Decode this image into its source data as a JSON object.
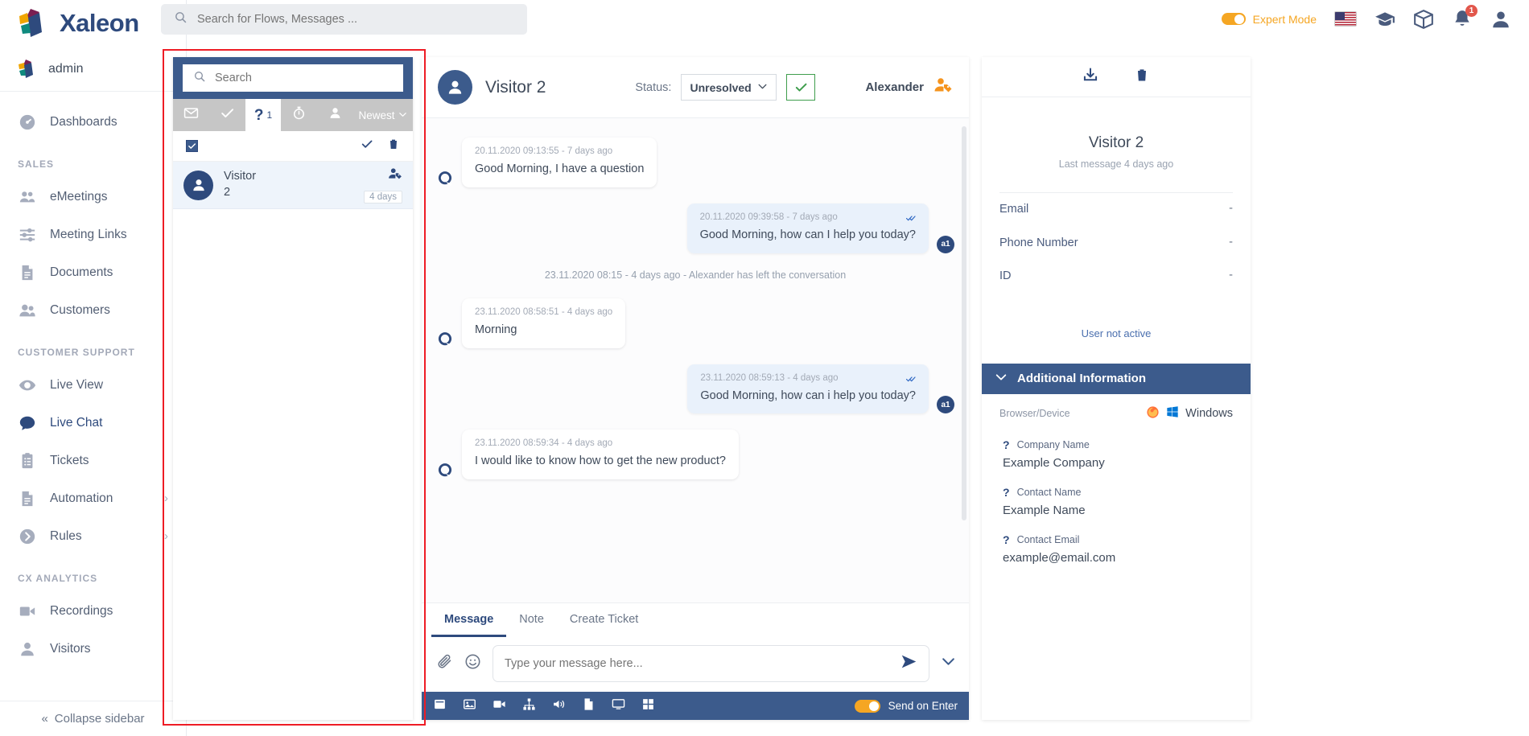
{
  "brand": {
    "name": "Xaleon",
    "user": "admin"
  },
  "topbar": {
    "search_placeholder": "Search for Flows, Messages ...",
    "expert_mode": "Expert Mode",
    "notification_count": "1"
  },
  "sidebar": {
    "dashboards": "Dashboards",
    "sections": [
      {
        "title": "SALES",
        "items": [
          "eMeetings",
          "Meeting Links",
          "Documents",
          "Customers"
        ]
      },
      {
        "title": "CUSTOMER SUPPORT",
        "items": [
          "Live View",
          "Live Chat",
          "Tickets",
          "Automation",
          "Rules"
        ]
      },
      {
        "title": "CX ANALYTICS",
        "items": [
          "Recordings",
          "Visitors"
        ]
      }
    ],
    "collapse": "Collapse sidebar"
  },
  "conversation_list": {
    "search_placeholder": "Search",
    "tabs": [
      {
        "icon": "envelope-icon",
        "count": "",
        "active": false
      },
      {
        "icon": "check-icon",
        "count": "",
        "active": false
      },
      {
        "icon": "question-icon",
        "count": "1",
        "active": true
      },
      {
        "icon": "timer-icon",
        "count": "",
        "active": false
      },
      {
        "icon": "person-icon",
        "count": "",
        "active": false
      }
    ],
    "sort_label": "Newest",
    "items": [
      {
        "name_line1": "Visitor",
        "name_line2": "2",
        "age": "4 days"
      }
    ]
  },
  "chat": {
    "visitor_title": "Visitor 2",
    "status_label": "Status:",
    "status_value": "Unresolved",
    "agent_name": "Alexander",
    "messages": [
      {
        "type": "in",
        "time": "20.11.2020 09:13:55 - 7 days ago",
        "text": "Good Morning, I have a question"
      },
      {
        "type": "out",
        "time": "20.11.2020 09:39:58 - 7 days ago",
        "text": "Good Morning, how can I help you today?",
        "avatar": "a1"
      },
      {
        "type": "system",
        "text": "23.11.2020 08:15 - 4 days ago - Alexander has left the conversation"
      },
      {
        "type": "in",
        "time": "23.11.2020 08:58:51 - 4 days ago",
        "text": "Morning"
      },
      {
        "type": "out",
        "time": "23.11.2020 08:59:13 - 4 days ago",
        "text": "Good Morning, how can i help you today?",
        "avatar": "a1"
      },
      {
        "type": "in",
        "time": "23.11.2020 08:59:34 - 4 days ago",
        "text": "I would like to know how to get the new product?"
      }
    ],
    "composer_tabs": [
      "Message",
      "Note",
      "Create Ticket"
    ],
    "composer_active_tab": "Message",
    "composer_placeholder": "Type your message here...",
    "send_on_enter": "Send on Enter"
  },
  "info_panel": {
    "title": "Visitor 2",
    "last_message": "Last message 4 days ago",
    "fields": [
      {
        "key": "Email",
        "value": "-"
      },
      {
        "key": "Phone Number",
        "value": "-"
      },
      {
        "key": "ID",
        "value": "-"
      }
    ],
    "not_active": "User not active",
    "additional_title": "Additional Information",
    "browser_label": "Browser/Device",
    "browser_value": "Windows",
    "custom_fields": [
      {
        "label": "Company Name",
        "value": "Example Company"
      },
      {
        "label": "Contact Name",
        "value": "Example Name"
      },
      {
        "label": "Contact Email",
        "value": "example@email.com"
      }
    ]
  },
  "colors": {
    "brand_navy": "#2e4a7d",
    "panel_blue": "#3c5b8c",
    "accent_orange": "#f5a623",
    "annotation_red": "#ee1c25",
    "success_green": "#3f9e4d"
  }
}
